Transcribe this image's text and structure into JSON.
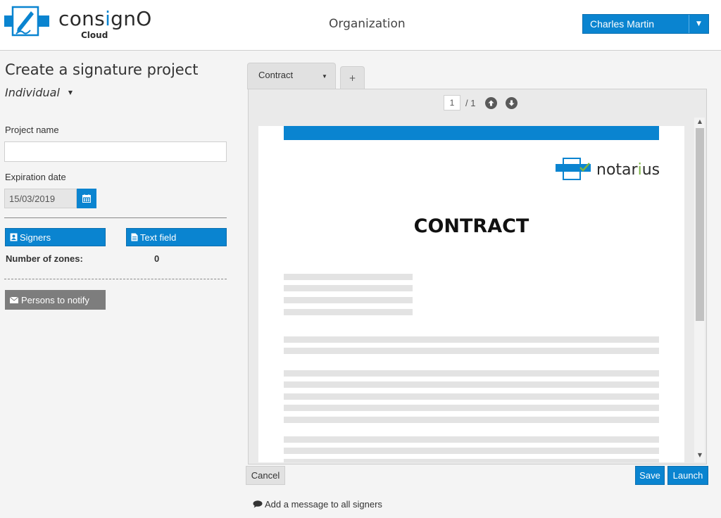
{
  "header": {
    "brand_prefix": "cons",
    "brand_i": "i",
    "brand_suffix": "gnO",
    "brand_sub": "Cloud",
    "org": "Organization",
    "user": "Charles Martin"
  },
  "form": {
    "title": "Create a signature project",
    "project_type": "Individual",
    "project_name_label": "Project name",
    "project_name_value": "",
    "expiration_label": "Expiration date",
    "expiration_value": "15/03/2019",
    "signers_tab": "Signers",
    "textfield_tab": "Text field",
    "zones_label": "Number of zones:",
    "zones_count": "0",
    "notify_button": "Persons to notify"
  },
  "document": {
    "tab_label": "Contract",
    "add_tab": "+",
    "current_page": "1",
    "total_pages": "/ 1",
    "logo_prefix": "notar",
    "logo_i": "i",
    "logo_suffix": "us",
    "heading": "CONTRACT"
  },
  "actions": {
    "cancel": "Cancel",
    "save": "Save",
    "launch": "Launch",
    "message_link": "Add a message to all signers"
  },
  "colors": {
    "primary": "#0a84d0",
    "secondary_button": "#7d7d7d",
    "logo_accent": "#7cb342"
  },
  "icons": {
    "user_menu": "caret-down-icon",
    "calendar": "calendar-icon",
    "signers": "user-badge-icon",
    "text_field": "document-icon",
    "notify": "envelope-icon",
    "page_up": "arrow-up-circle-icon",
    "page_down": "arrow-down-circle-icon",
    "message": "speech-bubble-icon"
  }
}
